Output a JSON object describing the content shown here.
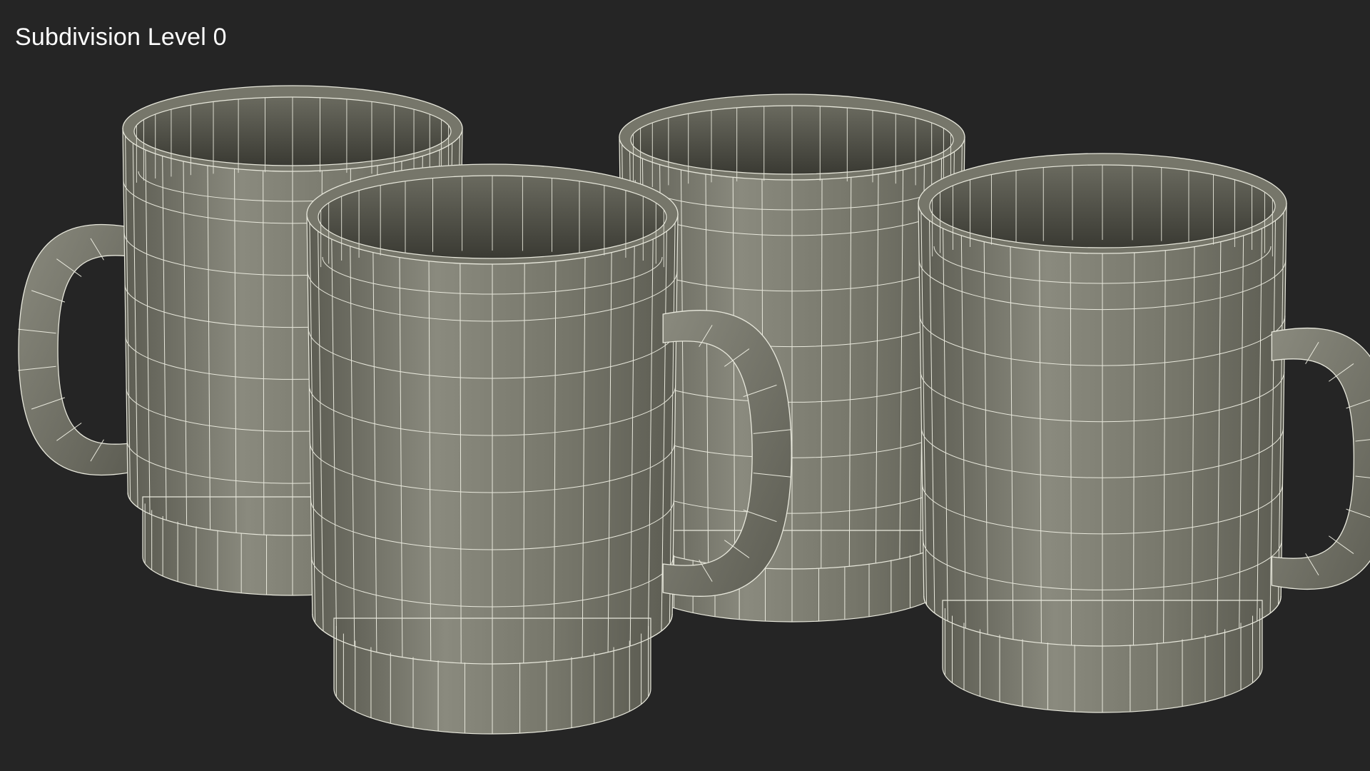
{
  "viewport": {
    "label": "Subdivision Level 0",
    "background_color": "#252525"
  },
  "render": {
    "subject": "four low-poly coffee mugs with wireframe overlay",
    "object_count": 4,
    "colors": {
      "mug_light": "#8a8a7e",
      "mug_mid": "#76766a",
      "mug_dark": "#5c5c52",
      "interior": "#3a3a33",
      "wire": "#e8e8dc"
    }
  }
}
